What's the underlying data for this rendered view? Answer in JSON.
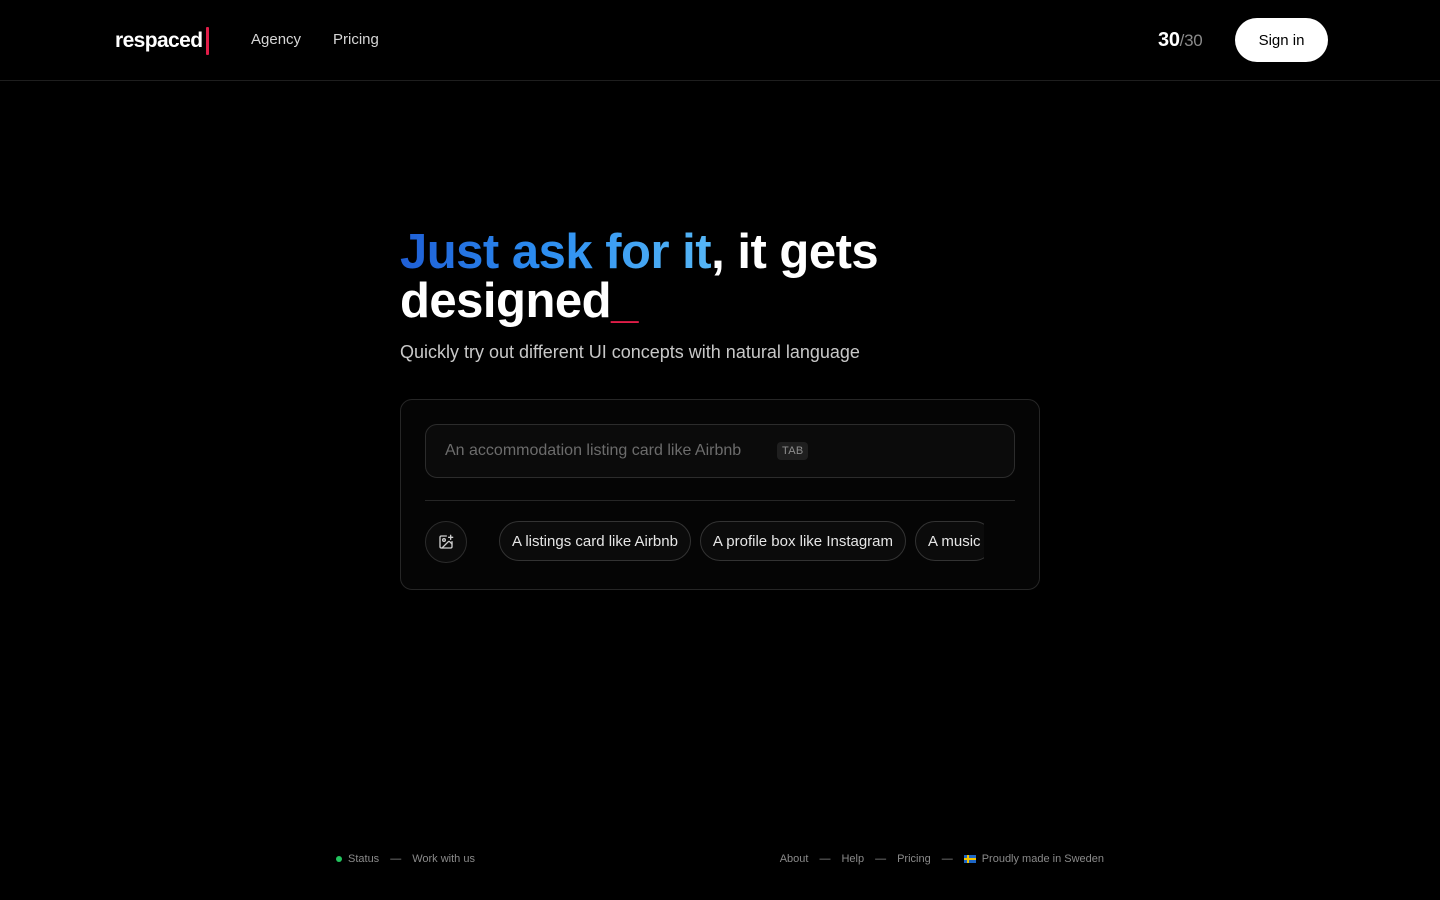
{
  "header": {
    "logo_text": "respaced",
    "nav": [
      {
        "label": "Agency"
      },
      {
        "label": "Pricing"
      }
    ],
    "credits": {
      "used": "30",
      "total": "/30"
    },
    "sign_in_label": "Sign in"
  },
  "hero": {
    "headline_highlight": "Just ask for it",
    "headline_rest": ", it gets designed",
    "headline_cursor": "_",
    "subtitle": "Quickly try out different UI concepts with natural language"
  },
  "prompt": {
    "placeholder": "An accommodation listing card like Airbnb",
    "value": "",
    "tab_hint": "TAB",
    "image_button_icon": "image-add-icon",
    "suggestions": [
      {
        "label": "A listings card like Airbnb"
      },
      {
        "label": "A profile box like Instagram"
      },
      {
        "label": "A music"
      }
    ]
  },
  "footer": {
    "left": [
      {
        "label": "Status"
      },
      {
        "label": "Work with us"
      }
    ],
    "right": [
      {
        "label": "About"
      },
      {
        "label": "Help"
      },
      {
        "label": "Pricing"
      },
      {
        "label": "Proudly made in Sweden"
      }
    ],
    "separator": "—"
  },
  "colors": {
    "background": "#000000",
    "accent_red": "#e11d48",
    "gradient_start": "#1f5fd6",
    "gradient_end": "#55b6f6",
    "status_green": "#22c55e"
  }
}
